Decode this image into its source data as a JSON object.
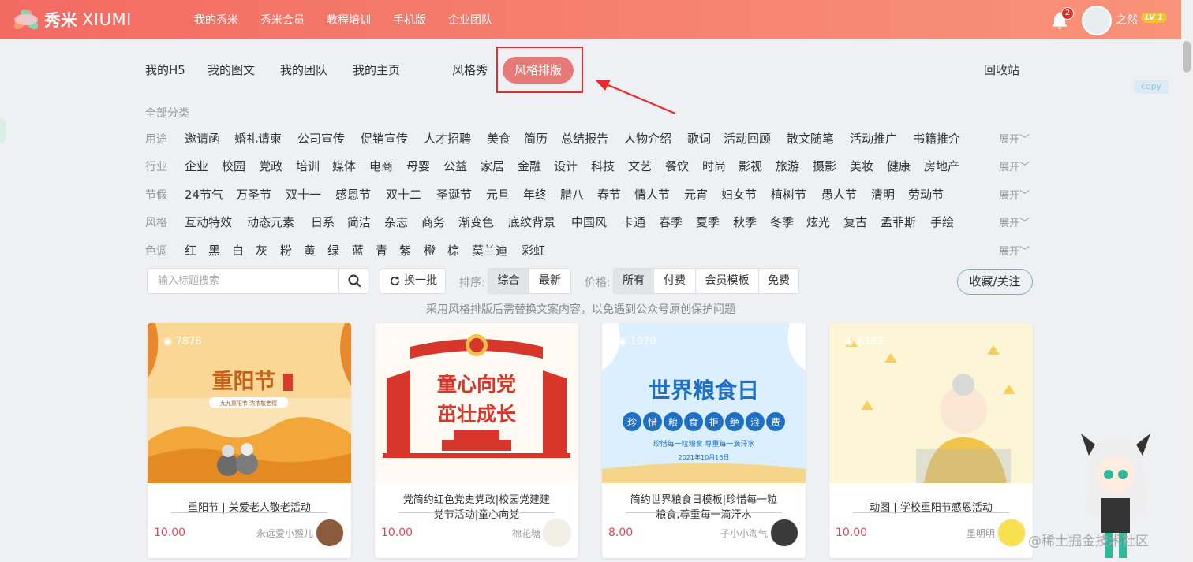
{
  "header": {
    "logo_cn": "秀米",
    "logo_en": "XIUMI",
    "nav": [
      "我的秀米",
      "秀米会员",
      "教程培训",
      "手机版",
      "企业团队"
    ],
    "notification_count": "2",
    "user_name": "之然",
    "user_level": "LV 1"
  },
  "tabs": {
    "items": [
      "我的H5",
      "我的图文",
      "我的团队",
      "我的主页",
      "风格秀"
    ],
    "active": "风格排版",
    "recycle": "回收站"
  },
  "copy_badge": "copy",
  "filters": {
    "all_label": "全部分类",
    "expand_label": "展开",
    "rows": [
      {
        "label": "用途",
        "items": [
          "邀请函",
          "婚礼请柬",
          "公司宣传",
          "促销宣传",
          "人才招聘",
          "美食",
          "简历",
          "总结报告",
          "人物介绍",
          "歌词",
          "活动回顾",
          "散文随笔",
          "活动推广",
          "书籍推介"
        ]
      },
      {
        "label": "行业",
        "items": [
          "企业",
          "校园",
          "党政",
          "培训",
          "媒体",
          "电商",
          "母婴",
          "公益",
          "家居",
          "金融",
          "设计",
          "科技",
          "文艺",
          "餐饮",
          "时尚",
          "影视",
          "旅游",
          "摄影",
          "美妆",
          "健康",
          "房地产"
        ]
      },
      {
        "label": "节假",
        "items": [
          "24节气",
          "万圣节",
          "双十一",
          "感恩节",
          "双十二",
          "圣诞节",
          "元旦",
          "年终",
          "腊八",
          "春节",
          "情人节",
          "元宵",
          "妇女节",
          "植树节",
          "愚人节",
          "清明",
          "劳动节"
        ]
      },
      {
        "label": "风格",
        "items": [
          "互动特效",
          "动态元素",
          "日系",
          "简洁",
          "杂志",
          "商务",
          "渐变色",
          "底纹背景",
          "中国风",
          "卡通",
          "春季",
          "夏季",
          "秋季",
          "冬季",
          "炫光",
          "复古",
          "孟菲斯",
          "手绘"
        ]
      },
      {
        "label": "色调",
        "items": [
          "红",
          "黑",
          "白",
          "灰",
          "粉",
          "黄",
          "绿",
          "蓝",
          "青",
          "紫",
          "橙",
          "棕",
          "莫兰迪",
          "彩虹"
        ]
      }
    ]
  },
  "toolbar": {
    "search_placeholder": "输入标题搜索",
    "refresh_label": "换一批",
    "sort_label": "排序:",
    "sort_options": [
      "综合",
      "最新"
    ],
    "price_label": "价格:",
    "price_options": [
      "所有",
      "付费",
      "会员模板",
      "免费"
    ],
    "favorite_label": "收藏/关注"
  },
  "notice": "采用风格排版后需替换文案内容，以免遇到公众号原创保护问题",
  "cards": [
    {
      "views": "7878",
      "title": "重阳节 | 关爱老人敬老活动",
      "price": "10.00",
      "author": "永远爱小猴儿",
      "art_title": "重阳节",
      "art_sub": "九九重阳节 浓浓敬老情"
    },
    {
      "views": "1709",
      "title": "党简约红色党史党政|校园党建建党节活动|童心向党",
      "price": "10.00",
      "author": "棉花糖",
      "art_title": "童心向党",
      "art_sub": "茁壮成长"
    },
    {
      "views": "1070",
      "title": "简约世界粮食日模板|珍惜每一粒粮食,尊重每一滴汗水",
      "price": "8.00",
      "author": "子小小淘气",
      "art_title": "世界粮食日",
      "art_chars": [
        "珍",
        "惜",
        "粮",
        "食",
        "拒",
        "绝",
        "浪",
        "费"
      ],
      "art_sub": "珍惜每一粒粮食 尊重每一滴汗水",
      "art_date": "2021年10月16日"
    },
    {
      "views": "6383",
      "title": "动图 | 学校重阳节感恩活动",
      "price": "10.00",
      "author": "墨明明"
    }
  ],
  "watermark": "@稀土掘金技术社区",
  "colors": {
    "header_start": "#f36a63",
    "header_end": "#f89378",
    "active_tab": "#e57a78",
    "highlight": "#e52d2d",
    "price": "#e0465a"
  }
}
